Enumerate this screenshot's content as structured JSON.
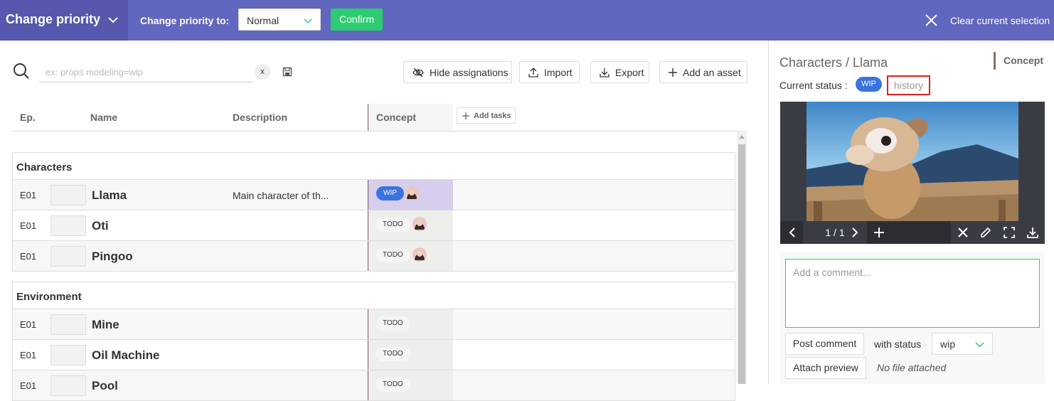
{
  "topbar": {
    "title": "Change priority",
    "priority_label": "Change priority to:",
    "priority_value": "Normal",
    "confirm_label": "Confirm",
    "clear_label": "Clear current selection"
  },
  "search": {
    "placeholder": "ex: props modeling=wip",
    "clear_label": "x"
  },
  "toolbar": {
    "hide_label": "Hide assignations",
    "import_label": "Import",
    "export_label": "Export",
    "add_label": "Add an asset"
  },
  "table": {
    "headers": {
      "ep": "Ep.",
      "name": "Name",
      "description": "Description",
      "concept": "Concept",
      "add_tasks": "Add tasks"
    },
    "sections": [
      {
        "title": "Characters",
        "rows": [
          {
            "ep": "E01",
            "name": "Llama",
            "description": "Main character of th...",
            "status": "WIP"
          },
          {
            "ep": "E01",
            "name": "Oti",
            "description": "",
            "status": "TODO"
          },
          {
            "ep": "E01",
            "name": "Pingoo",
            "description": "",
            "status": "TODO"
          }
        ]
      },
      {
        "title": "Environment",
        "rows": [
          {
            "ep": "E01",
            "name": "Mine",
            "description": "",
            "status": "TODO"
          },
          {
            "ep": "E01",
            "name": "Oil Machine",
            "description": "",
            "status": "TODO"
          },
          {
            "ep": "E01",
            "name": "Pool",
            "description": "",
            "status": "TODO"
          }
        ]
      }
    ]
  },
  "panel": {
    "title": "Characters / Llama",
    "task_type": "Concept",
    "status_label": "Current status :",
    "status": "WIP",
    "history_label": "history",
    "preview_page": "1 / 1",
    "comment_placeholder": "Add a comment...",
    "post_label": "Post comment",
    "with_status_label": "with status",
    "status_option": "wip",
    "attach_label": "Attach preview",
    "no_file_label": "No file attached"
  },
  "colors": {
    "topbar": "#6166be",
    "confirm": "#2ecc71",
    "wip": "#3873e0",
    "selected_cell": "#d7cdec",
    "history_outline": "#e02020"
  }
}
